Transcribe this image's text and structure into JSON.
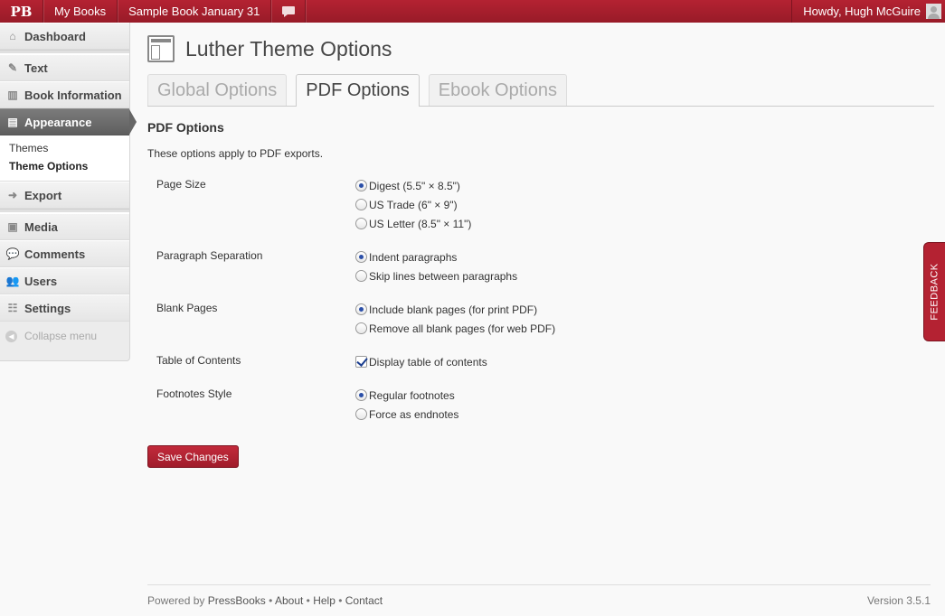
{
  "adminbar": {
    "logo": "PB",
    "my_books": "My Books",
    "book_title": "Sample Book January 31",
    "greeting": "Howdy, Hugh McGuire"
  },
  "sidebar": {
    "dashboard": "Dashboard",
    "text": "Text",
    "book_information": "Book Information",
    "appearance": "Appearance",
    "submenu": {
      "themes": "Themes",
      "theme_options": "Theme Options"
    },
    "export": "Export",
    "media": "Media",
    "comments": "Comments",
    "users": "Users",
    "settings": "Settings",
    "collapse": "Collapse menu"
  },
  "main": {
    "page_title": "Luther Theme Options",
    "tabs": [
      "Global Options",
      "PDF Options",
      "Ebook Options"
    ],
    "active_tab": "PDF Options",
    "section_title": "PDF Options",
    "description": "These options apply to PDF exports.",
    "fields": {
      "page_size": {
        "label": "Page Size",
        "options": [
          "Digest (5.5\" × 8.5\")",
          "US Trade (6\" × 9\")",
          "US Letter (8.5\" × 11\")"
        ],
        "selected": "Digest (5.5\" × 8.5\")"
      },
      "paragraph_separation": {
        "label": "Paragraph Separation",
        "options": [
          "Indent paragraphs",
          "Skip lines between paragraphs"
        ],
        "selected": "Indent paragraphs"
      },
      "blank_pages": {
        "label": "Blank Pages",
        "options": [
          "Include blank pages (for print PDF)",
          "Remove all blank pages (for web PDF)"
        ],
        "selected": "Include blank pages (for print PDF)"
      },
      "toc": {
        "label": "Table of Contents",
        "checkbox_label": "Display table of contents",
        "checked": true
      },
      "footnotes": {
        "label": "Footnotes Style",
        "options": [
          "Regular footnotes",
          "Force as endnotes"
        ],
        "selected": "Regular footnotes"
      }
    },
    "save_label": "Save Changes"
  },
  "footer": {
    "powered_by": "Powered by",
    "links": [
      "PressBooks",
      "About",
      "Help",
      "Contact"
    ],
    "version": "Version 3.5.1"
  },
  "feedback": "FEEDBACK",
  "colors": {
    "brand": "#b42232",
    "active_menu": "#6b6b6b",
    "radio_dot": "#2b4fa8"
  }
}
